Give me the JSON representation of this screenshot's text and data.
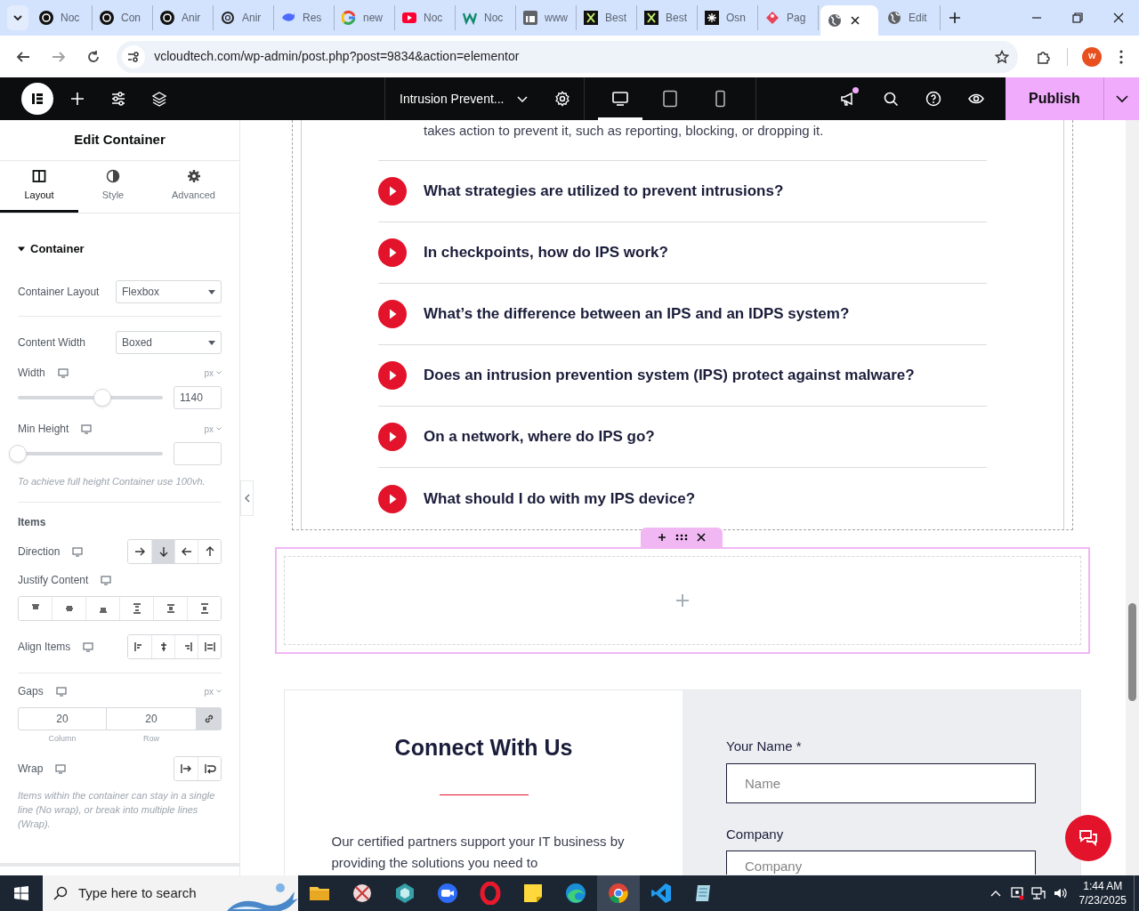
{
  "browser": {
    "tabs": [
      {
        "label": "Noc",
        "kind": "ring",
        "selected": false
      },
      {
        "label": "Con",
        "kind": "ring",
        "selected": false
      },
      {
        "label": "Anir",
        "kind": "ring",
        "selected": false
      },
      {
        "label": "Anir",
        "kind": "ring-outline",
        "selected": false
      },
      {
        "label": "Res",
        "kind": "whale",
        "selected": false
      },
      {
        "label": "new",
        "kind": "multicolor",
        "selected": false
      },
      {
        "label": "Noc",
        "kind": "play",
        "selected": false
      },
      {
        "label": "Noc",
        "kind": "zigzag",
        "selected": false
      },
      {
        "label": "www",
        "kind": "square",
        "selected": false
      },
      {
        "label": "Best",
        "kind": "cross",
        "selected": false
      },
      {
        "label": "Best",
        "kind": "cross",
        "selected": false
      },
      {
        "label": "Osn",
        "kind": "spark",
        "selected": false
      },
      {
        "label": "Pag",
        "kind": "tag",
        "selected": false
      },
      {
        "kind": "globe",
        "selected": true
      },
      {
        "label": "Edit",
        "kind": "globe",
        "selected": false
      }
    ],
    "url": "vcloudtech.com/wp-admin/post.php?post=9834&action=elementor",
    "profile": "W"
  },
  "editor_bar": {
    "document_title": "Intrusion Prevent...",
    "devices": [
      {
        "kind": "desktop",
        "selected": true
      },
      {
        "kind": "tablet",
        "selected": false
      },
      {
        "kind": "mobile",
        "selected": false
      }
    ],
    "notification": true,
    "publish": "Publish"
  },
  "panel": {
    "title": "Edit Container",
    "tabs": [
      {
        "label": "Layout",
        "selected": true
      },
      {
        "label": "Style",
        "selected": false
      },
      {
        "label": "Advanced",
        "selected": false
      }
    ],
    "section": {
      "title": "Container",
      "expanded": true
    },
    "container_layout": {
      "label": "Container Layout",
      "value": "Flexbox"
    },
    "content_width": {
      "label": "Content Width",
      "value": "Boxed"
    },
    "width": {
      "label": "Width",
      "unit": "px",
      "level": 0.58,
      "value": "1140"
    },
    "min_height": {
      "label": "Min Height",
      "unit": "px",
      "level": 0
    },
    "min_height_note": "To achieve full height Container use 100vh.",
    "items_heading": "Items",
    "direction": {
      "label": "Direction",
      "options": [
        {
          "kind": "right",
          "selected": false
        },
        {
          "kind": "down",
          "selected": true
        },
        {
          "kind": "left",
          "selected": false
        },
        {
          "kind": "up",
          "selected": false
        }
      ]
    },
    "justify_content": {
      "label": "Justify Content",
      "options": [
        {
          "kind": "start",
          "selected": false
        },
        {
          "kind": "center",
          "selected": false
        },
        {
          "kind": "end",
          "selected": false
        },
        {
          "kind": "between",
          "selected": false
        },
        {
          "kind": "around",
          "selected": false
        },
        {
          "kind": "evenly",
          "selected": false
        }
      ]
    },
    "align_items": {
      "label": "Align Items",
      "options": [
        {
          "kind": "start",
          "selected": false
        },
        {
          "kind": "center",
          "selected": false
        },
        {
          "kind": "end",
          "selected": false
        },
        {
          "kind": "stretch",
          "selected": false
        }
      ]
    },
    "gaps": {
      "label": "Gaps",
      "unit": "px",
      "column": "20",
      "row": "20",
      "column_label": "Column",
      "row_label": "Row",
      "linked": true
    },
    "wrap": {
      "label": "Wrap",
      "options": [
        {
          "kind": "nowrap",
          "selected": false
        },
        {
          "kind": "wrap",
          "selected": false
        }
      ]
    },
    "wrap_note": "Items within the container can stay in a single line (No wrap), or break into multiple lines (Wrap)."
  },
  "page": {
    "faq_partial_text": "takes action to prevent it, such as reporting, blocking, or dropping it.",
    "faq": [
      "What strategies are utilized to prevent intrusions?",
      "In checkpoints, how do IPS work?",
      "What’s the difference between an IPS and an IDPS system?",
      "Does an intrusion prevention system (IPS) protect against malware?",
      "On a network, where do IPS go?",
      "What should I do with my IPS device?"
    ],
    "contact": {
      "title": "Connect With Us",
      "text": "Our certified partners support your IT business by providing the solutions you need to",
      "fields": [
        {
          "label": "Your Name *",
          "placeholder": "Name"
        },
        {
          "label": "Company",
          "placeholder": "Company"
        }
      ]
    }
  },
  "taskbar": {
    "search_placeholder": "Type here to search",
    "apps": [
      {
        "kind": "folder",
        "selected": false
      },
      {
        "kind": "snip",
        "selected": false
      },
      {
        "kind": "gem",
        "selected": false
      },
      {
        "kind": "zoom",
        "selected": false
      },
      {
        "kind": "opera",
        "selected": false
      },
      {
        "kind": "sticky",
        "selected": false
      },
      {
        "kind": "edge",
        "selected": false
      },
      {
        "kind": "chrome",
        "selected": true
      },
      {
        "kind": "vscode",
        "selected": false
      },
      {
        "kind": "notepad",
        "selected": false
      }
    ],
    "time": "1:44 AM",
    "date": "7/23/2025"
  }
}
